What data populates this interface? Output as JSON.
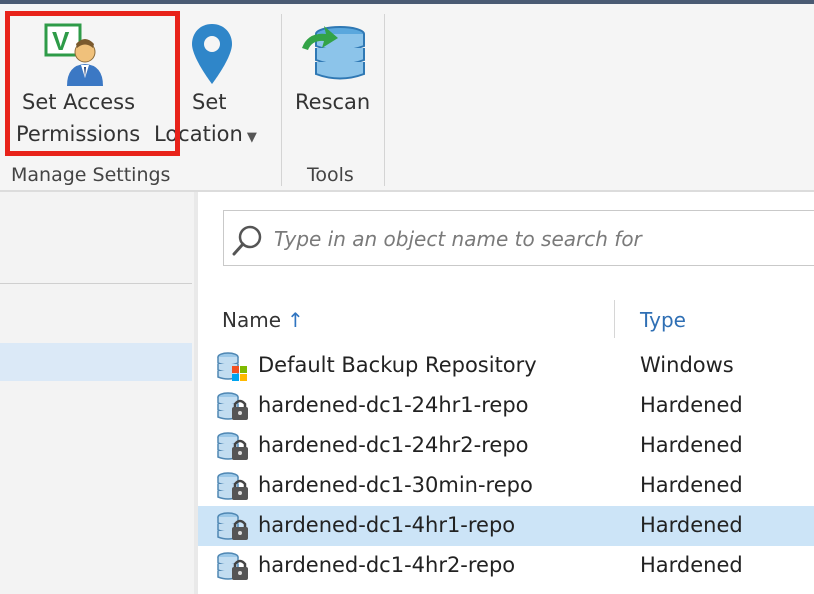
{
  "ribbon": {
    "groups": [
      {
        "label": "Manage Settings"
      },
      {
        "label": "Tools"
      }
    ],
    "buttons": {
      "set_access_permissions": {
        "line1": "Set Access",
        "line2": "Permissions",
        "icon": "user-permissions-icon"
      },
      "set_location": {
        "line1": "Set",
        "line2": "Location",
        "icon": "location-pin-icon"
      },
      "rescan": {
        "line1": "Rescan",
        "icon": "rescan-database-icon"
      }
    }
  },
  "search": {
    "placeholder": "Type in an object name to search for"
  },
  "grid": {
    "columns": {
      "name": "Name",
      "type": "Type"
    },
    "sort_indicator": "↑",
    "rows": [
      {
        "name": "Default Backup Repository",
        "type": "Windows",
        "icon": "windows-repository-icon",
        "selected": false
      },
      {
        "name": "hardened-dc1-24hr1-repo",
        "type": "Hardened",
        "icon": "hardened-repository-icon",
        "selected": false
      },
      {
        "name": "hardened-dc1-24hr2-repo",
        "type": "Hardened",
        "icon": "hardened-repository-icon",
        "selected": false
      },
      {
        "name": "hardened-dc1-30min-repo",
        "type": "Hardened",
        "icon": "hardened-repository-icon",
        "selected": false
      },
      {
        "name": "hardened-dc1-4hr1-repo",
        "type": "Hardened",
        "icon": "hardened-repository-icon",
        "selected": true
      },
      {
        "name": "hardened-dc1-4hr2-repo",
        "type": "Hardened",
        "icon": "hardened-repository-icon",
        "selected": false
      }
    ]
  },
  "colors": {
    "highlight": "#e8231a",
    "selection": "#cce4f7",
    "accent": "#2f74c0"
  }
}
